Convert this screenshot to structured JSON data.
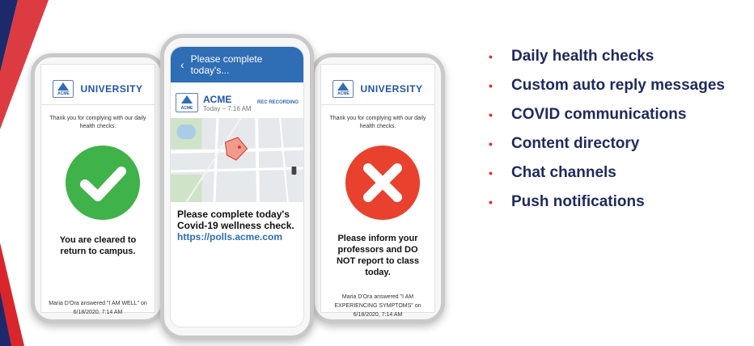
{
  "left_phone": {
    "brand": "UNIVERSITY",
    "logo_text": "ACME",
    "thanks": "Thank you for complying with our daily health checks.",
    "result": "You are cleared to return to campus.",
    "answered": "Maria D'Ora answered \"I AM WELL\" on 6/18/2020, 7:14 AM",
    "icon": "check-icon",
    "circle_color": "#3fb34a"
  },
  "middle_phone": {
    "topbar_title": "Please complete today's...",
    "sender": "ACME",
    "time": "Today – 7:16 AM",
    "recording": "REC RECORDING",
    "logo_text": "ACME",
    "message": "Please complete today's Covid-19 wellness check.",
    "link": "https://polls.acme.com"
  },
  "right_phone": {
    "brand": "UNIVERSITY",
    "logo_text": "ACME",
    "thanks": "Thank you for complying with our daily health checks.",
    "result": "Please inform your professors and DO NOT report to class today.",
    "answered": "Maria D'Ora answered \"I AM EXPERIENCING SYMPTOMS\" on 6/18/2020, 7:14 AM",
    "icon": "x-icon",
    "circle_color": "#e8412d"
  },
  "features": [
    "Daily health checks",
    "Custom auto reply messages",
    "COVID communications",
    "Content directory",
    "Chat channels",
    "Push notifications"
  ],
  "colors": {
    "bullet_dot": "#d6342c",
    "bullet_text": "#1e2a5c",
    "brand_blue": "#2f6db5",
    "stripe_navy": "#1c2a6b",
    "stripe_red": "#d8262c"
  }
}
